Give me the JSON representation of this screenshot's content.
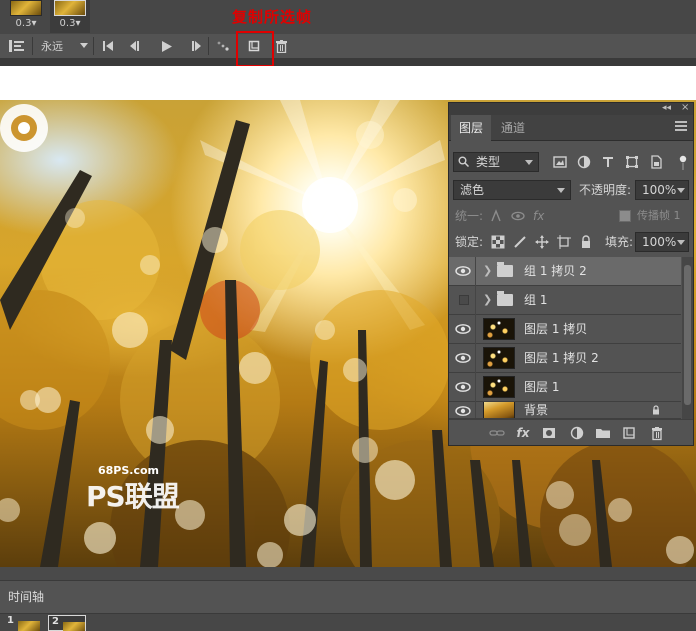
{
  "annotation": {
    "text": "复制所选帧",
    "color": "#e00000"
  },
  "top_timeline": {
    "frames": [
      {
        "delay": "0.3",
        "selected": false
      },
      {
        "delay": "0.3",
        "selected": true
      }
    ],
    "loop_option": "永远",
    "buttons": [
      "convert-timeline-icon",
      "first-frame-icon",
      "previous-frame-icon",
      "play-icon",
      "next-frame-icon",
      "tween-icon",
      "duplicate-frame-icon",
      "delete-frame-icon"
    ]
  },
  "canvas": {
    "watermark_url": "68PS.com",
    "watermark_text": "PS联盟"
  },
  "layers_panel": {
    "tabs": [
      {
        "label": "图层",
        "active": true
      },
      {
        "label": "通道",
        "active": false
      }
    ],
    "filter": {
      "label": "类型"
    },
    "blend_mode": "滤色",
    "opacity_label": "不透明度:",
    "opacity_value": "100%",
    "unify_label": "统一:",
    "propagate_label": "传播帧 1",
    "lock_label": "锁定:",
    "fill_label": "填充:",
    "fill_value": "100%",
    "layers": [
      {
        "name": "组 1 拷贝 2",
        "type": "group",
        "visible": true,
        "selected": true,
        "locked": false
      },
      {
        "name": "组 1",
        "type": "group",
        "visible": false,
        "selected": false,
        "locked": false
      },
      {
        "name": "图层 1 拷贝",
        "type": "sparkle",
        "visible": true,
        "selected": false,
        "locked": false
      },
      {
        "name": "图层 1 拷贝 2",
        "type": "sparkle",
        "visible": true,
        "selected": false,
        "locked": false
      },
      {
        "name": "图层 1",
        "type": "sparkle",
        "visible": true,
        "selected": false,
        "locked": false
      },
      {
        "name": "背景",
        "type": "photo",
        "visible": true,
        "selected": false,
        "locked": true
      }
    ],
    "footer": [
      "link-icon",
      "fx-icon",
      "mask-icon",
      "adjustment-icon",
      "folder-icon",
      "new-layer-icon",
      "trash-icon"
    ],
    "footer_fx": "fx"
  },
  "bottom_timeline": {
    "tab_label": "时间轴",
    "frames": [
      {
        "number": "1",
        "selected": false
      },
      {
        "number": "2",
        "selected": true
      }
    ]
  }
}
